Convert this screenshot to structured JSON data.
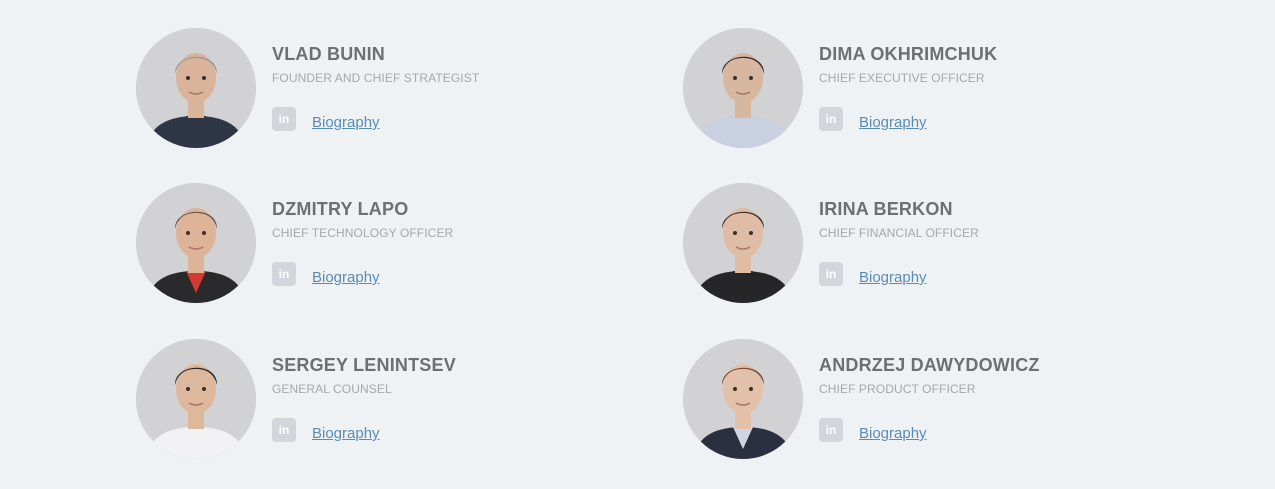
{
  "team": [
    {
      "name": "VLAD BUNIN",
      "role": "FOUNDER AND CHIEF STRATEGIST",
      "linkedin_label": "in",
      "bio_label": "Biography",
      "photo": "portrait-photo",
      "hair": "#9a9790",
      "skin": "#d9b39a",
      "clothing": "#2e3545",
      "shirt": "#2e3545"
    },
    {
      "name": "DIMA OKHRIMCHUK",
      "role": "CHIEF EXECUTIVE OFFICER",
      "linkedin_label": "in",
      "bio_label": "Biography",
      "photo": "portrait-photo",
      "hair": "#3a2e28",
      "skin": "#d8b7a0",
      "clothing": "#c9d1e0",
      "shirt": "#c9d1e0"
    },
    {
      "name": "DZMITRY LAPO",
      "role": "CHIEF TECHNOLOGY OFFICER",
      "linkedin_label": "in",
      "bio_label": "Biography",
      "photo": "portrait-photo",
      "hair": "#6b5a48",
      "skin": "#ddb49a",
      "clothing": "#2a2a2d",
      "shirt": "#d23a32"
    },
    {
      "name": "IRINA BERKON",
      "role": "CHIEF FINANCIAL OFFICER",
      "linkedin_label": "in",
      "bio_label": "Biography",
      "photo": "portrait-photo",
      "hair": "#4a3426",
      "skin": "#dfbca6",
      "clothing": "#262628",
      "shirt": "#262628"
    },
    {
      "name": "SERGEY LENINTSEV",
      "role": "GENERAL COUNSEL",
      "linkedin_label": "in",
      "bio_label": "Biography",
      "photo": "portrait-photo",
      "hair": "#2d2520",
      "skin": "#deb89c",
      "clothing": "#f2f2f4",
      "shirt": "#f2f2f4"
    },
    {
      "name": "ANDRZEJ DAWYDOWICZ",
      "role": "CHIEF PRODUCT OFFICER",
      "linkedin_label": "in",
      "bio_label": "Biography",
      "photo": "portrait-photo",
      "hair": "#7a4e33",
      "skin": "#e2c0aa",
      "clothing": "#2b3040",
      "shirt": "#cfd6e3"
    }
  ],
  "colors": {
    "background": "#eef2f5",
    "name": "#6f6f6f",
    "role": "#a3a8ad",
    "link": "#5a8bb5",
    "linkedin_badge": "#d2d6dc"
  }
}
